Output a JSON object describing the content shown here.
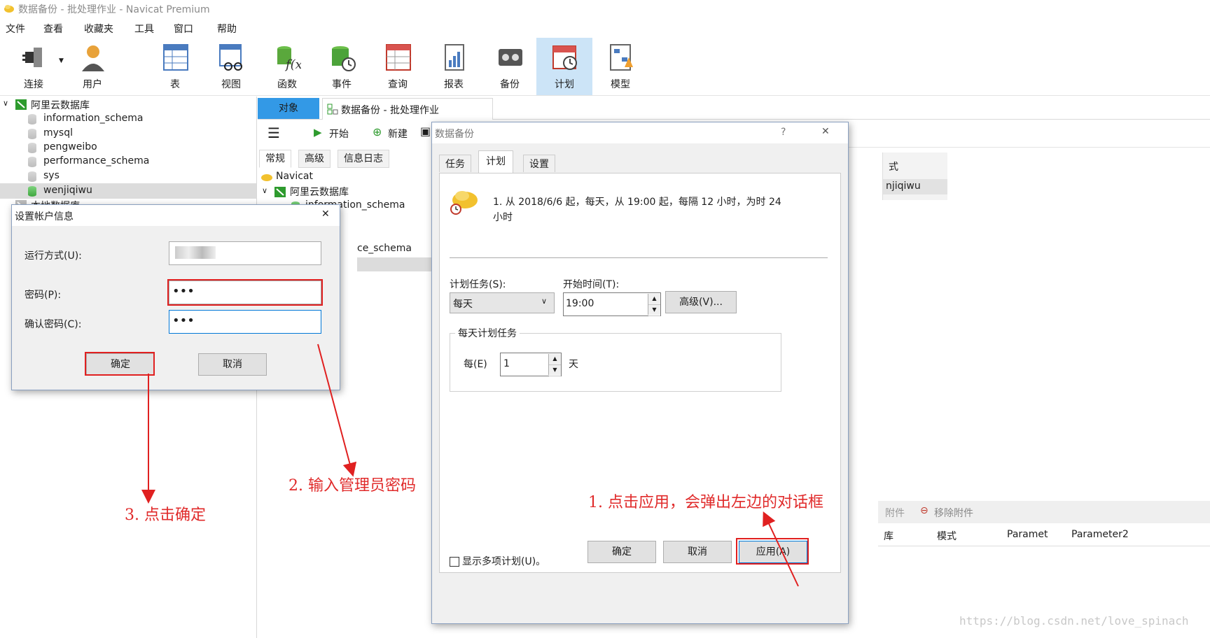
{
  "window": {
    "title": "数据备份 - 批处理作业 - Navicat Premium"
  },
  "menu": [
    "文件",
    "查看",
    "收藏夹",
    "工具",
    "窗口",
    "帮助"
  ],
  "toolbar": [
    "连接",
    "用户",
    "表",
    "视图",
    "函数",
    "事件",
    "查询",
    "报表",
    "备份",
    "计划",
    "模型"
  ],
  "sidebar": {
    "connection": "阿里云数据库",
    "databases": [
      "information_schema",
      "mysql",
      "pengweibo",
      "performance_schema",
      "sys",
      "wenjiqiwu"
    ],
    "local": "本地数据库"
  },
  "tabs": {
    "objects": "对象",
    "job": "数据备份 - 批处理作业"
  },
  "subtoolbar": {
    "start": "开始",
    "new": "新建"
  },
  "subtabs": [
    "常规",
    "高级",
    "信息日志"
  ],
  "middle_tree": {
    "root": "Navicat",
    "connection": "阿里云数据库",
    "db": "information_schema",
    "partial": "ce_schema"
  },
  "right_panel": {
    "col_fragment": "式",
    "row_fragment": "njiqiwu",
    "attach_fragment": "附件",
    "remove_attach": "移除附件",
    "cols": [
      "库",
      "模式",
      "Paramet",
      "Parameter2"
    ]
  },
  "backup_dialog": {
    "title": "数据备份",
    "help": "?",
    "close": "✕",
    "tabs": [
      "任务",
      "计划",
      "设置"
    ],
    "summary_1": "1. 从 2018/6/6 起，每天，从 19:00 起，每隔 12 小时，为时 24",
    "summary_2": "小时",
    "schedule_label": "计划任务(S):",
    "schedule_value": "每天",
    "start_label": "开始时间(T):",
    "start_value": "19:00",
    "advanced": "高级(V)...",
    "group_title": "每天计划任务",
    "every_label": "每(E)",
    "every_value": "1",
    "day_unit": "天",
    "multi_checkbox": "显示多项计划(U)。",
    "ok": "确定",
    "cancel": "取消",
    "apply": "应用(A)"
  },
  "account_dialog": {
    "title": "设置帐户信息",
    "close": "✕",
    "run_as_label": "运行方式(U):",
    "password_label": "密码(P):",
    "password_value": "•••",
    "confirm_label": "确认密码(C):",
    "confirm_value": "•••",
    "ok": "确定",
    "cancel": "取消"
  },
  "annotations": {
    "a1": "1. 点击应用，会弹出左边的对话框",
    "a2": "2. 输入管理员密码",
    "a3": "3. 点击确定"
  },
  "watermark": "https://blog.csdn.net/love_spinach",
  "colors": {
    "accent": "#3399e6",
    "selected_tool": "#cce4f7",
    "annotation": "#e02020"
  }
}
